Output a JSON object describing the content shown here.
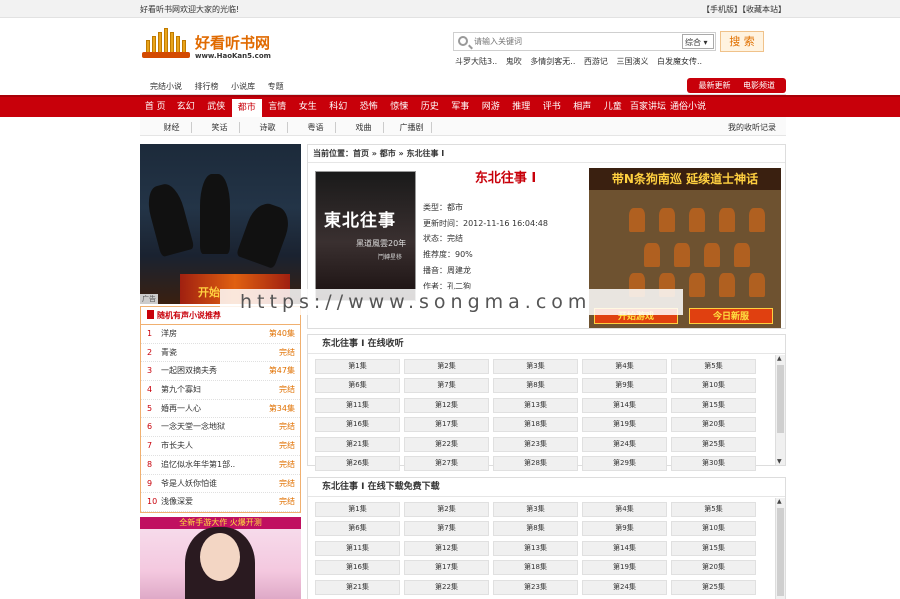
{
  "topbar": {
    "welcome": "好看听书网欢迎大家的光临!",
    "links": "【手机版】【收藏本站】"
  },
  "header": {
    "brand": "好看听书网",
    "brand_sub": "www.HaoKan5.com",
    "search_placeholder": "请输入关键词",
    "search_select": "综合",
    "search_button": "搜 索",
    "hot_searches": [
      "斗罗大陆3..",
      "鬼吹",
      "多情剑客无..",
      "西游记",
      "三国演义",
      "白发魔女传.."
    ]
  },
  "subnav": {
    "items": [
      "完结小说",
      "排行榜",
      "小说库",
      "专题"
    ],
    "right_buttons": [
      "最新更新",
      "电影频道"
    ]
  },
  "mainnav": {
    "items": [
      "首 页",
      "玄幻",
      "武侠",
      "都市",
      "言情",
      "女生",
      "科幻",
      "恐怖",
      "惊悚",
      "历史",
      "军事",
      "网游",
      "推理",
      "评书",
      "相声",
      "儿童",
      "百家讲坛",
      "通俗小说"
    ],
    "active_index": 3
  },
  "secnav": {
    "items": [
      "财经",
      "笑话",
      "诗歌",
      "粤语",
      "戏曲",
      "广播剧"
    ],
    "history": "我的收听记录"
  },
  "left": {
    "banner_text": "开始",
    "ad_tag": "广告",
    "rank_title": "随机有声小说推荐",
    "rank": [
      {
        "num": "1",
        "title": "洋房",
        "status": "第40集"
      },
      {
        "num": "2",
        "title": "青瓷",
        "status": "完结"
      },
      {
        "num": "3",
        "title": "一起困双摘夫秀",
        "status": "第47集"
      },
      {
        "num": "4",
        "title": "第九个寡妇",
        "status": "完结"
      },
      {
        "num": "5",
        "title": "婚再一人心",
        "status": "第34集"
      },
      {
        "num": "6",
        "title": "一念天堂一念地狱",
        "status": "完结"
      },
      {
        "num": "7",
        "title": "市长夫人",
        "status": "完结"
      },
      {
        "num": "8",
        "title": "追忆似水年华第1部..",
        "status": "完结"
      },
      {
        "num": "9",
        "title": "爷是人妖你怕谁",
        "status": "完结"
      },
      {
        "num": "10",
        "title": "浅像深爱",
        "status": "完结"
      }
    ],
    "bottom_banner": "全新手游大作 火爆开测"
  },
  "info": {
    "breadcrumb": "当前位置：首页 » 都市 » 东北往事 I",
    "title": "东北往事 I",
    "cover_title": "東北往事",
    "cover_sub": "黑道風雲20年",
    "cover_sub2": "鬥轉星移",
    "meta": {
      "type": "类型：都市",
      "updated": "更新时间：2012-11-16 16:04:48",
      "state": "状态：完结",
      "rating": "推荐度：90%",
      "narrator": "播音：周建龙",
      "author": "作者：孔二狗"
    },
    "ad_title": "带N条狗南巡 延续道士神话",
    "ad_btn1": "开始游戏",
    "ad_btn2": "今日新服"
  },
  "online": {
    "title": "东北往事 I 在线收听",
    "episodes": [
      "第1集",
      "第2集",
      "第3集",
      "第4集",
      "第5集",
      "第6集",
      "第7集",
      "第8集",
      "第9集",
      "第10集",
      "第11集",
      "第12集",
      "第13集",
      "第14集",
      "第15集",
      "第16集",
      "第17集",
      "第18集",
      "第19集",
      "第20集",
      "第21集",
      "第22集",
      "第23集",
      "第24集",
      "第25集",
      "第26集",
      "第27集",
      "第28集",
      "第29集",
      "第30集"
    ]
  },
  "download": {
    "title": "东北往事 I 在线下载免费下载",
    "episodes": [
      "第1集",
      "第2集",
      "第3集",
      "第4集",
      "第5集",
      "第6集",
      "第7集",
      "第8集",
      "第9集",
      "第10集",
      "第11集",
      "第12集",
      "第13集",
      "第14集",
      "第15集",
      "第16集",
      "第17集",
      "第18集",
      "第19集",
      "第20集",
      "第21集",
      "第22集",
      "第23集",
      "第24集",
      "第25集"
    ]
  },
  "watermark": "https://www.songma.com"
}
